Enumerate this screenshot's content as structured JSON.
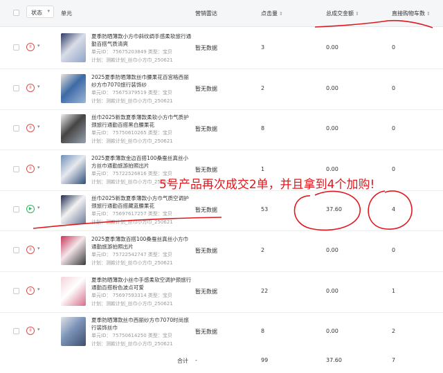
{
  "header": {
    "status_label": "状态",
    "cols": {
      "unit": "单元",
      "radar": "营销雷达",
      "clicks": "点击量",
      "gmv": "总成交金额",
      "cart": "直接购物车数"
    }
  },
  "rows": [
    {
      "status": "paused",
      "title": "夏季防晒薄款小方巾斜纹绸手感柔软旅行通勤百搭气质清爽",
      "id_line": "单元ID： 75675203849  类型：宝贝",
      "plan_line": "计划：测款计划_丝巾小方巾_250621",
      "radar": "暂无数据",
      "clicks": "3",
      "gmv": "0.00",
      "cart": "0",
      "thumb_colors": [
        "#2e3a66",
        "#d9dde8",
        "#8fa3c7"
      ]
    },
    {
      "status": "paused",
      "title": "2025夏季防晒薄款丝巾腰果花百宫格西丽纱方巾7070旅行装饰纱",
      "id_line": "单元ID： 75675379519  类型：宝贝",
      "plan_line": "计划：测款计划_丝巾小方巾_250621",
      "radar": "暂无数据",
      "clicks": "2",
      "gmv": "0.00",
      "cart": "0",
      "thumb_colors": [
        "#e8e3dc",
        "#3d6aa6",
        "#a0b6d6"
      ]
    },
    {
      "status": "paused",
      "title": "丝巾2025新款夏季薄款柔软小方巾气质护颈旅行通勤百搭黑白腰果花",
      "id_line": "单元ID： 75750610265  类型：宝贝",
      "plan_line": "计划：测款计划_丝巾小方巾_250621",
      "radar": "暂无数据",
      "clicks": "8",
      "gmv": "0.00",
      "cart": "0",
      "thumb_colors": [
        "#f0f0f0",
        "#444444",
        "#9aa4b0"
      ]
    },
    {
      "status": "paused",
      "title": "2025夏季薄款金边百搭100桑蚕丝真丝小方丝巾通勤旅游拍照出片",
      "id_line": "单元ID： 75722526816  类型：宝贝",
      "plan_line": "计划：测款计划_丝巾小方巾_250621",
      "radar": "暂无数据",
      "clicks": "1",
      "gmv": "0.00",
      "cart": "0",
      "thumb_colors": [
        "#6f8fb8",
        "#e7e9ee",
        "#2f4d7a"
      ]
    },
    {
      "status": "active",
      "title": "丝巾2025新款夏季薄款小方巾气质空调护颈旅行通勤百搭藏蓝腰果花",
      "id_line": "单元ID： 75697617257  类型：宝贝",
      "plan_line": "计划：测款计划_丝巾小方巾_250621",
      "radar": "暂无数据",
      "clicks": "53",
      "gmv": "37.60",
      "cart": "4",
      "thumb_colors": [
        "#1f2b4d",
        "#f2f2f2",
        "#6c7a99"
      ]
    },
    {
      "status": "paused",
      "title": "2025夏季薄款百搭100桑蚕丝真丝小方巾通勤旅游拍照出片",
      "id_line": "单元ID： 75722542747  类型：宝贝",
      "plan_line": "计划：测款计划_丝巾小方巾_250621",
      "radar": "暂无数据",
      "clicks": "2",
      "gmv": "0.00",
      "cart": "0",
      "thumb_colors": [
        "#c7365a",
        "#f3e6e9",
        "#3b3b3b"
      ]
    },
    {
      "status": "paused",
      "title": "夏季防晒薄款小丝巾手感柔软空调护颈旅行通勤百搭粉色波点可爱",
      "id_line": "单元ID： 75697593314  类型：宝贝",
      "plan_line": "计划：测款计划_丝巾小方巾_250621",
      "radar": "暂无数据",
      "clicks": "22",
      "gmv": "0.00",
      "cart": "1",
      "thumb_colors": [
        "#f3d4dc",
        "#ffffff",
        "#d66f8a"
      ]
    },
    {
      "status": "paused",
      "title": "夏季防晒薄款丝巾西丽纱方巾7070时尚旅行装饰丝巾",
      "id_line": "单元ID： 75750614250  类型：宝贝",
      "plan_line": "计划：测款计划_丝巾小方巾_250621",
      "radar": "暂无数据",
      "clicks": "8",
      "gmv": "0.00",
      "cart": "2",
      "thumb_colors": [
        "#dfe2e8",
        "#7b93b8",
        "#3f4f6b"
      ]
    }
  ],
  "footer": {
    "label": "合计",
    "radar": "-",
    "clicks": "99",
    "gmv": "37.60",
    "cart": "7"
  },
  "annotation": {
    "text": "5号产品再次成交2单，并且拿到4个加购!",
    "color": "#e0171d"
  }
}
